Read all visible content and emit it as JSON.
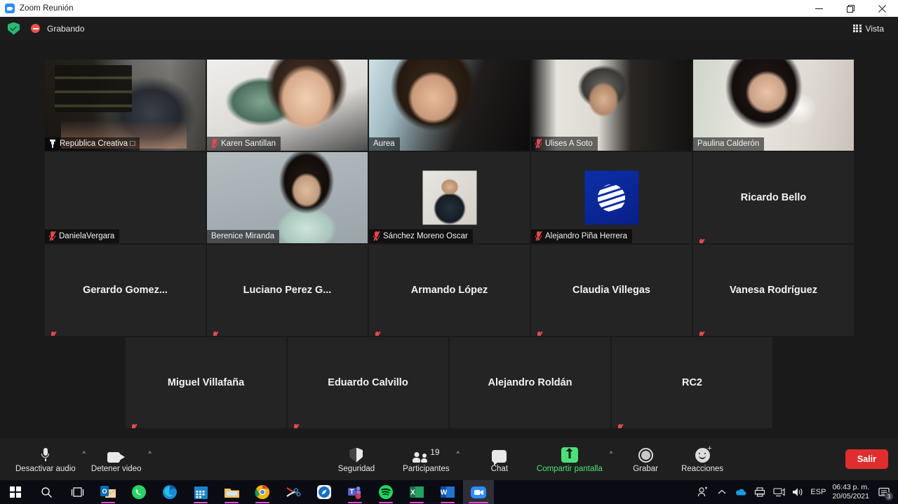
{
  "window": {
    "title": "Zoom Reunión",
    "app_icon": "zoom-icon",
    "minimize_label": "Minimizar",
    "maximize_label": "Maximizar",
    "close_label": "Cerrar"
  },
  "recording_bar": {
    "shield_icon": "shield-check-icon",
    "record_icon": "recording-dot-icon",
    "status_label": "Grabando",
    "view_button": "Vista",
    "view_icon": "grid-view-icon"
  },
  "participants": [
    {
      "name": "República Creativa □",
      "muted": false,
      "pinned": true,
      "speaking": true,
      "kind": "video",
      "video": "v-bar",
      "label_style": "overlay"
    },
    {
      "name": "Karen Santillan",
      "muted": true,
      "pinned": false,
      "speaking": false,
      "kind": "video",
      "video": "v-karen",
      "label_style": "overlay"
    },
    {
      "name": "Aurea",
      "muted": false,
      "pinned": false,
      "speaking": false,
      "kind": "video",
      "video": "v-aurea",
      "label_style": "overlay"
    },
    {
      "name": "Ulises A Soto",
      "muted": true,
      "pinned": false,
      "speaking": false,
      "kind": "video",
      "video": "v-ulises",
      "label_style": "overlay"
    },
    {
      "name": "Paulina Calderón",
      "muted": false,
      "pinned": false,
      "speaking": false,
      "kind": "video",
      "video": "v-paulina",
      "label_style": "overlay"
    },
    {
      "name": "DanielaVergara",
      "muted": true,
      "pinned": false,
      "speaking": false,
      "kind": "video",
      "video": "v-daniela",
      "label_style": "overlay"
    },
    {
      "name": "Berenice Miranda",
      "muted": false,
      "pinned": false,
      "speaking": false,
      "kind": "video",
      "video": "v-berenice",
      "label_style": "overlay"
    },
    {
      "name": "Sánchez Moreno Oscar",
      "muted": true,
      "pinned": false,
      "speaking": false,
      "kind": "avatar",
      "video": "",
      "label_style": "overlay"
    },
    {
      "name": "Alejandro Piña Herrera",
      "muted": true,
      "pinned": false,
      "speaking": false,
      "kind": "logo",
      "video": "",
      "label_style": "overlay"
    },
    {
      "name": "Ricardo Bello",
      "muted": true,
      "pinned": false,
      "speaking": false,
      "kind": "name",
      "video": "",
      "label_style": "center"
    },
    {
      "name": "Gerardo Gomez...",
      "muted": true,
      "pinned": false,
      "speaking": false,
      "kind": "name",
      "video": "",
      "label_style": "center"
    },
    {
      "name": "Luciano Perez G...",
      "muted": true,
      "pinned": false,
      "speaking": false,
      "kind": "name",
      "video": "",
      "label_style": "center"
    },
    {
      "name": "Armando López",
      "muted": true,
      "pinned": false,
      "speaking": false,
      "kind": "name",
      "video": "",
      "label_style": "center"
    },
    {
      "name": "Claudia Villegas",
      "muted": true,
      "pinned": false,
      "speaking": false,
      "kind": "name",
      "video": "",
      "label_style": "center"
    },
    {
      "name": "Vanesa Rodríguez",
      "muted": true,
      "pinned": false,
      "speaking": false,
      "kind": "name",
      "video": "",
      "label_style": "center"
    },
    {
      "name": "Miguel Villafaña",
      "muted": true,
      "pinned": false,
      "speaking": false,
      "kind": "name",
      "video": "",
      "label_style": "center"
    },
    {
      "name": "Eduardo Calvillo",
      "muted": true,
      "pinned": false,
      "speaking": false,
      "kind": "name",
      "video": "",
      "label_style": "center"
    },
    {
      "name": "Alejandro Roldán",
      "muted": false,
      "pinned": false,
      "speaking": false,
      "kind": "name",
      "video": "",
      "label_style": "center"
    },
    {
      "name": "RC2",
      "muted": true,
      "pinned": false,
      "speaking": false,
      "kind": "name",
      "video": "",
      "label_style": "center"
    }
  ],
  "toolbar": {
    "audio_label": "Desactivar audio",
    "audio_icon": "microphone-icon",
    "audio_caret": "^",
    "video_label": "Detener video",
    "video_icon": "camera-icon",
    "video_caret": "^",
    "security_label": "Seguridad",
    "security_icon": "shield-icon",
    "participants_label": "Participantes",
    "participants_icon": "people-icon",
    "participants_count": "19",
    "participants_caret": "^",
    "chat_label": "Chat",
    "chat_icon": "chat-bubble-icon",
    "share_label": "Compartir pantalla",
    "share_icon": "share-screen-icon",
    "share_caret": "^",
    "record_label": "Grabar",
    "record_icon": "record-circle-icon",
    "reactions_label": "Reacciones",
    "reactions_icon": "smiley-icon",
    "leave_label": "Salir",
    "accent_green": "#4ce07a",
    "leave_red": "#e02d2d"
  },
  "taskbar": {
    "items": [
      {
        "name": "start-button",
        "icon": "windows-logo-icon",
        "running": false,
        "active": false
      },
      {
        "name": "search-button",
        "icon": "search-icon",
        "running": false,
        "active": false
      },
      {
        "name": "task-view-button",
        "icon": "task-view-icon",
        "running": false,
        "active": false
      },
      {
        "name": "outlook-button",
        "icon": "outlook-icon",
        "running": true,
        "active": false
      },
      {
        "name": "whatsapp-button",
        "icon": "whatsapp-icon",
        "running": false,
        "active": false
      },
      {
        "name": "edge-button",
        "icon": "edge-icon",
        "running": false,
        "active": false
      },
      {
        "name": "calendar-button",
        "icon": "calendar-icon",
        "running": true,
        "active": false
      },
      {
        "name": "file-explorer-button",
        "icon": "folder-icon",
        "running": true,
        "active": false
      },
      {
        "name": "chrome-button",
        "icon": "chrome-icon",
        "running": true,
        "active": false
      },
      {
        "name": "snipping-tool-button",
        "icon": "scissors-icon",
        "running": false,
        "active": false
      },
      {
        "name": "browser-button",
        "icon": "compass-icon",
        "running": false,
        "active": false
      },
      {
        "name": "teams-button",
        "icon": "teams-icon",
        "running": true,
        "active": false
      },
      {
        "name": "spotify-button",
        "icon": "spotify-icon",
        "running": true,
        "active": false
      },
      {
        "name": "excel-button",
        "icon": "excel-icon",
        "running": true,
        "active": false
      },
      {
        "name": "word-button",
        "icon": "word-icon",
        "running": true,
        "active": false
      },
      {
        "name": "zoom-button",
        "icon": "zoom-icon",
        "running": true,
        "active": true
      }
    ],
    "tray": {
      "meet_now_icon": "meet-now-icon",
      "chevron_icon": "show-hidden-icons-icon",
      "onedrive_icon": "onedrive-icon",
      "printer_icon": "printer-icon",
      "network_icon": "network-icon",
      "volume_icon": "volume-icon",
      "language": "ESP",
      "time": "06:43 p. m.",
      "date": "20/05/2021",
      "notification_icon": "notifications-icon",
      "notification_count": "3"
    }
  }
}
